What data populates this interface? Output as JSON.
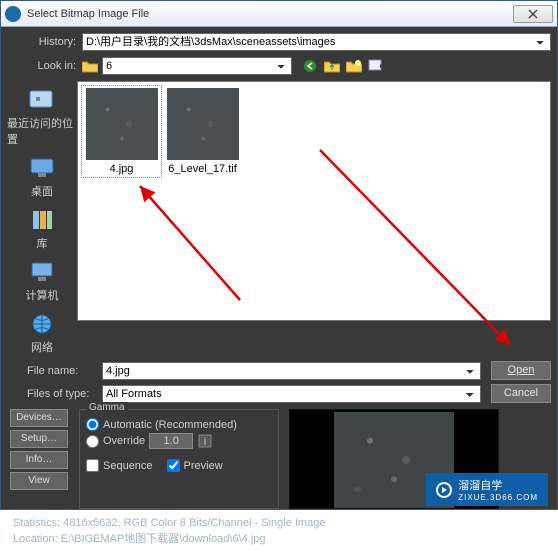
{
  "titlebar": {
    "title": "Select Bitmap Image File"
  },
  "history": {
    "label": "History:",
    "value": "D:\\用户目录\\我的文档\\3dsMax\\sceneassets\\images"
  },
  "lookin": {
    "label": "Look in:",
    "value": "6"
  },
  "places": [
    {
      "label": "最近访问的位置"
    },
    {
      "label": "桌面"
    },
    {
      "label": "库"
    },
    {
      "label": "计算机"
    },
    {
      "label": "网络"
    }
  ],
  "files": [
    {
      "name": "4.jpg",
      "selected": true
    },
    {
      "name": "6_Level_17.tif",
      "selected": false
    }
  ],
  "filename": {
    "label": "File name:",
    "value": "4.jpg"
  },
  "filetype": {
    "label": "Files of type:",
    "value": "All Formats"
  },
  "buttons": {
    "open": "Open",
    "cancel": "Cancel"
  },
  "side_buttons": {
    "devices": "Devices…",
    "setup": "Setup…",
    "info": "Info…",
    "view": "View"
  },
  "gamma": {
    "legend": "Gamma",
    "auto": "Automatic (Recommended)",
    "override": "Override",
    "override_value": "1.0",
    "sequence": "Sequence",
    "preview": "Preview",
    "preview_checked": true,
    "sequence_checked": false,
    "selected": "auto"
  },
  "stats": {
    "line1": "Statistics: 4816x5632, RGB Color 8 Bits/Channel - Single Image",
    "line2": "Location: E:\\BIGEMAP地图下载器\\download\\6\\4.jpg"
  },
  "watermark": {
    "text": "溜溜自学",
    "sub": "ZIXUE.3D66.COM"
  }
}
